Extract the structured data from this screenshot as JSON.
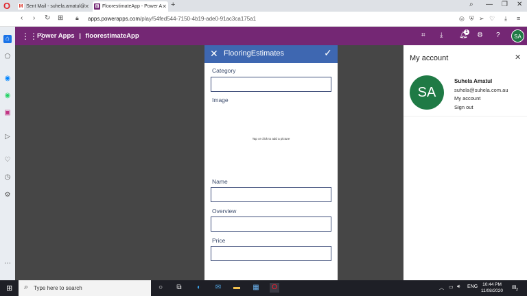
{
  "browser": {
    "tabs": [
      {
        "label": "Sent Mail - suhela.amatul@",
        "favicon": "gmail-icon",
        "active": false
      },
      {
        "label": "FloorestimateApp - Power A",
        "favicon": "powerapps-icon",
        "active": true
      }
    ],
    "url_prefix": "apps.powerapps.com",
    "url_path": "/play/54fed544-7150-4b19-ade0-91ac3ca175a1"
  },
  "app_header": {
    "product": "Power Apps",
    "separator": "|",
    "app_name": "floorestimateApp",
    "notification_count": "1",
    "user_initials": "SA"
  },
  "form": {
    "title": "FlooringEstimates",
    "fields": {
      "category": {
        "label": "Category",
        "value": ""
      },
      "image": {
        "label": "Image",
        "hint": "Tap or click to add a picture"
      },
      "name": {
        "label": "Name",
        "value": ""
      },
      "overview": {
        "label": "Overview",
        "value": ""
      },
      "price": {
        "label": "Price",
        "value": ""
      }
    }
  },
  "account_pane": {
    "title": "My account",
    "initials": "SA",
    "name": "Suhela Amatul",
    "email": "suhela@suhela.com.au",
    "my_account_link": "My account",
    "sign_out_link": "Sign out"
  },
  "taskbar": {
    "search_placeholder": "Type here to search",
    "language": "ENG",
    "time": "10:44 PM",
    "date": "11/08/2020",
    "notification_count": "2"
  },
  "colors": {
    "app_header": "#742774",
    "form_header": "#3e67b1",
    "avatar": "#1f7a45",
    "canvas": "#464646"
  }
}
